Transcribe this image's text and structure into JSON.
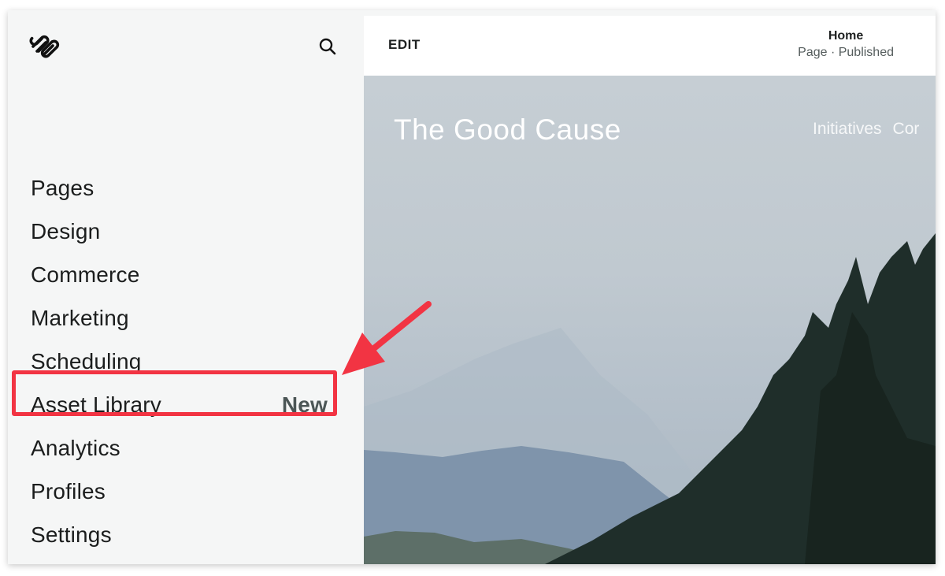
{
  "sidebar": {
    "logo": "squarespace-logo",
    "search_icon": "search-icon",
    "items": [
      {
        "label": "Pages",
        "badge": ""
      },
      {
        "label": "Design",
        "badge": ""
      },
      {
        "label": "Commerce",
        "badge": ""
      },
      {
        "label": "Marketing",
        "badge": ""
      },
      {
        "label": "Scheduling",
        "badge": ""
      },
      {
        "label": "Asset Library",
        "badge": "New"
      },
      {
        "label": "Analytics",
        "badge": ""
      },
      {
        "label": "Profiles",
        "badge": ""
      },
      {
        "label": "Settings",
        "badge": ""
      }
    ]
  },
  "topbar": {
    "edit_label": "EDIT",
    "page_title": "Home",
    "page_status": "Page · Published"
  },
  "site": {
    "title": "The Good Cause",
    "nav": [
      "Initiatives",
      "Cor"
    ]
  },
  "annotation": {
    "color": "#f23443",
    "highlighted_item": "Asset Library"
  }
}
